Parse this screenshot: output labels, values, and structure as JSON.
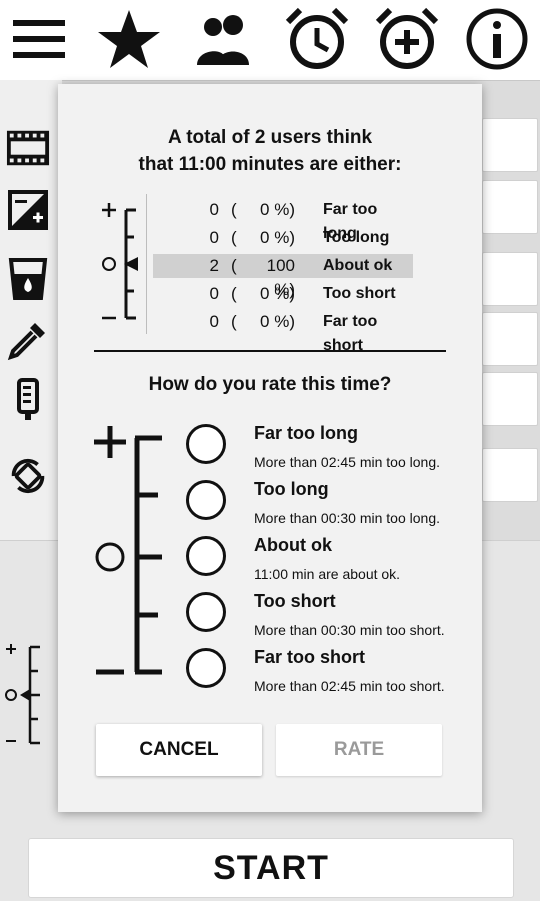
{
  "toolbar": {
    "icons": [
      "menu-icon",
      "star-icon",
      "users-icon",
      "alarm-clock-icon",
      "add-alarm-icon",
      "info-icon"
    ]
  },
  "side_icons": [
    "film-strip-icon",
    "exposure-icon",
    "glass-drop-icon",
    "pipette-icon",
    "thermometer-icon",
    "rotate-icon"
  ],
  "dialog": {
    "title_line1": "A total of 2 users think",
    "title_line2": "that 11:00 minutes are either:",
    "stats": [
      {
        "count": "0",
        "open": "(",
        "pct": "0 %)",
        "label": "Far too long"
      },
      {
        "count": "0",
        "open": "(",
        "pct": "0 %)",
        "label": "Too long"
      },
      {
        "count": "2",
        "open": "(",
        "pct": "100 %)",
        "label": "About ok"
      },
      {
        "count": "0",
        "open": "(",
        "pct": "0 %)",
        "label": "Too short"
      },
      {
        "count": "0",
        "open": "(",
        "pct": "0 %)",
        "label": "Far too short"
      }
    ],
    "question": "How do you rate this time?",
    "options": [
      {
        "title": "Far too long",
        "desc": "More than 02:45 min too long."
      },
      {
        "title": "Too long",
        "desc": "More than 00:30 min too long."
      },
      {
        "title": "About ok",
        "desc": "11:00 min are about ok."
      },
      {
        "title": "Too short",
        "desc": "More than 00:30 min too short."
      },
      {
        "title": "Far too short",
        "desc": "More than 02:45 min too short."
      }
    ],
    "cancel_label": "CANCEL",
    "rate_label": "RATE"
  },
  "start_label": "START",
  "colors": {
    "highlight": "#d0d0d0",
    "rate_disabled": "#9a9a9a",
    "dialog_bg": "#f2f2f2"
  }
}
